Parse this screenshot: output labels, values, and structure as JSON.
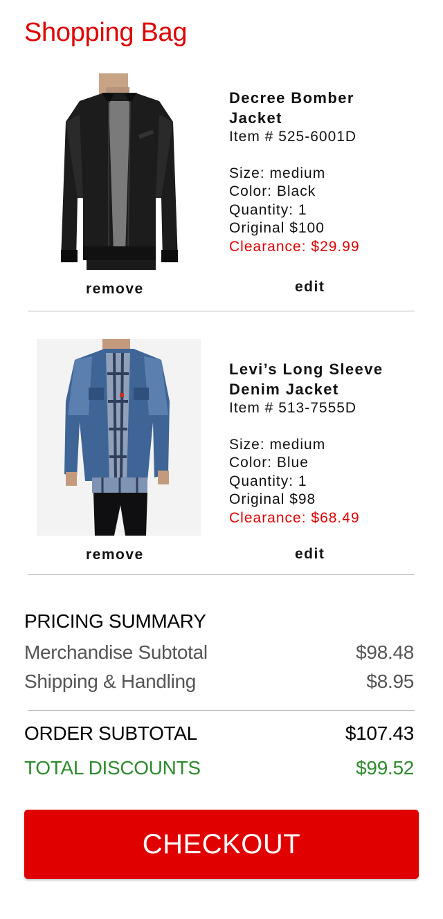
{
  "page_title": "Shopping Bag",
  "products": [
    {
      "name_line1": "Decree Bomber",
      "name_line2": "Jacket",
      "item_no": "Item # 525-6001D",
      "size": "Size: medium",
      "color": "Color: Black",
      "quantity": "Quantity: 1",
      "original": "Original $100",
      "clearance": "Clearance: $29.99",
      "remove_label": "remove",
      "edit_label": "edit"
    },
    {
      "name_line1": "Levi’s Long Sleeve",
      "name_line2": "Denim Jacket",
      "item_no": "Item # 513-7555D",
      "size": "Size: medium",
      "color": "Color: Blue",
      "quantity": "Quantity: 1",
      "original": "Original $98",
      "clearance": "Clearance: $68.49",
      "remove_label": "remove",
      "edit_label": "edit"
    }
  ],
  "summary": {
    "heading": "PRICING SUMMARY",
    "merch_label": "Merchandise Subtotal",
    "merch_value": "$98.48",
    "shipping_label": "Shipping & Handling",
    "shipping_value": "$8.95",
    "order_label": "ORDER SUBTOTAL",
    "order_value": "$107.43",
    "discount_label": "TOTAL DISCOUNTS",
    "discount_value": "$99.52"
  },
  "checkout_label": "CHECKOUT",
  "colors": {
    "brand_red": "#e00000",
    "discount_green": "#2e8b2e"
  }
}
